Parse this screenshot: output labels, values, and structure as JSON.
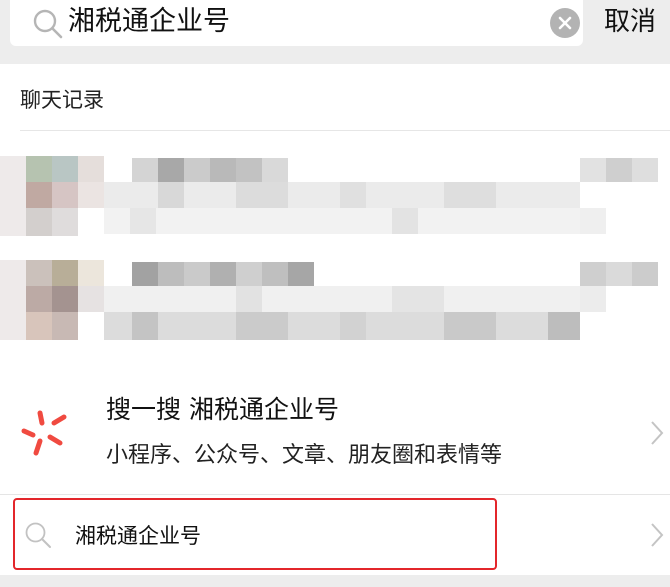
{
  "search": {
    "query": "湘税通企业号",
    "cancel_label": "取消"
  },
  "chat_records": {
    "title": "聊天记录"
  },
  "sousou": {
    "title": "搜一搜  湘税通企业号",
    "subtitle": "小程序、公众号、文章、朋友圈和表情等"
  },
  "suggestion": {
    "text": "湘税通企业号"
  },
  "colors": {
    "highlight_border": "#e3262b",
    "logo_red": "#f04a40",
    "background": "#ededed"
  }
}
